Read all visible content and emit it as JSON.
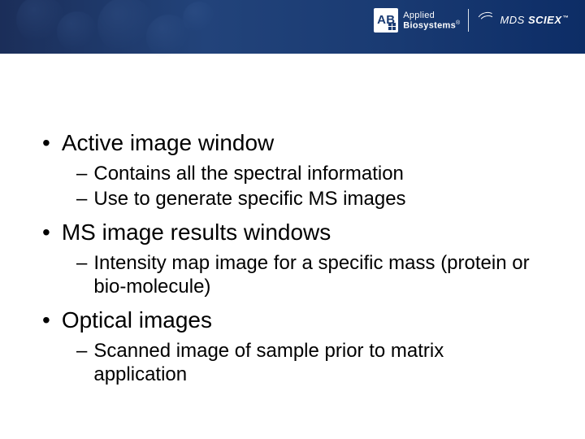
{
  "header": {
    "brand_ab_tile": "AB",
    "brand_applied_line1": "Applied",
    "brand_applied_line2": "Biosystems",
    "brand_mds": "MDS",
    "brand_sciex": "SCIEX",
    "tm": "™",
    "reg": "®"
  },
  "bullets": [
    {
      "text": "Active image window",
      "subs": [
        "Contains all the spectral information",
        "Use to generate specific MS images"
      ]
    },
    {
      "text": "MS image results windows",
      "subs": [
        "Intensity map image for a specific mass (protein or bio-molecule)"
      ]
    },
    {
      "text": "Optical images",
      "subs": [
        "Scanned image of sample prior to matrix application"
      ]
    }
  ],
  "glyphs": {
    "bullet": "•",
    "dash": "–"
  }
}
